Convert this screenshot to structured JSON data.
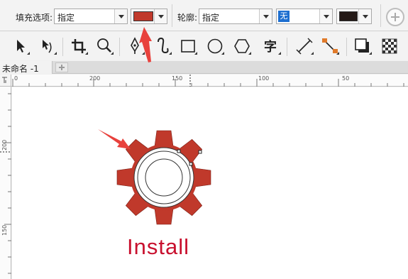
{
  "property_bar": {
    "fill_label": "填充选项:",
    "fill_mode": "指定",
    "fill_color": "#c0392b",
    "outline_label": "轮廓:",
    "outline_mode": "指定",
    "outline_width": "无",
    "outline_color": "#231815"
  },
  "toolbox": {
    "tools": [
      {
        "name": "pick-tool-icon"
      },
      {
        "name": "shape-edit-tool-icon"
      },
      {
        "name": "crop-tool-icon"
      },
      {
        "name": "zoom-tool-icon"
      },
      {
        "name": "pen-tool-icon"
      },
      {
        "name": "artistic-media-tool-icon"
      },
      {
        "name": "rectangle-tool-icon"
      },
      {
        "name": "ellipse-tool-icon"
      },
      {
        "name": "polygon-tool-icon"
      },
      {
        "name": "text-tool-icon",
        "glyph": "字"
      },
      {
        "name": "dimension-tool-icon"
      },
      {
        "name": "connector-tool-icon"
      },
      {
        "name": "drop-shadow-tool-icon"
      },
      {
        "name": "transparency-tool-icon"
      }
    ]
  },
  "document": {
    "tab_title": "未命名 -1"
  },
  "rulers": {
    "horizontal": [
      "0",
      "200",
      "150",
      "100",
      "50"
    ],
    "vertical": [
      "200",
      "150"
    ]
  },
  "canvas": {
    "gear_color": "#c0392b",
    "text": "Install",
    "text_color": "#c8102e"
  },
  "annotations": {
    "arrow_color": "#e8413c"
  }
}
